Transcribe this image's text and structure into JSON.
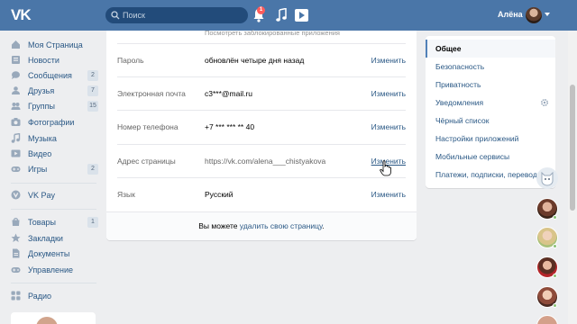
{
  "header": {
    "logo_text": "VK",
    "search_placeholder": "Поиск",
    "notifications_count": "1",
    "user_name": "Алёна"
  },
  "sidebar": {
    "items": [
      {
        "label": "Моя Страница",
        "icon": "home-icon",
        "count": ""
      },
      {
        "label": "Новости",
        "icon": "news-icon",
        "count": ""
      },
      {
        "label": "Сообщения",
        "icon": "messages-icon",
        "count": "2"
      },
      {
        "label": "Друзья",
        "icon": "friends-icon",
        "count": "7"
      },
      {
        "label": "Группы",
        "icon": "groups-icon",
        "count": "15"
      },
      {
        "label": "Фотографии",
        "icon": "camera-icon",
        "count": ""
      },
      {
        "label": "Музыка",
        "icon": "music-icon",
        "count": ""
      },
      {
        "label": "Видео",
        "icon": "video-icon",
        "count": ""
      },
      {
        "label": "Игры",
        "icon": "games-icon",
        "count": "2"
      }
    ],
    "vkpay": {
      "label": "VK Pay",
      "icon": "vkpay-icon"
    },
    "items2": [
      {
        "label": "Товары",
        "icon": "goods-icon",
        "count": "1"
      },
      {
        "label": "Закладки",
        "icon": "star-icon",
        "count": ""
      },
      {
        "label": "Документы",
        "icon": "document-icon",
        "count": ""
      },
      {
        "label": "Управление",
        "icon": "gamepad-icon",
        "count": ""
      }
    ],
    "radio": {
      "label": "Радио",
      "icon": "apps-icon"
    }
  },
  "settings": {
    "faded_text": "Посмотреть заблокированные приложения",
    "rows": [
      {
        "label": "Пароль",
        "value": "обновлён четыре дня назад",
        "action": "Изменить"
      },
      {
        "label": "Электронная почта",
        "value": "c3***@mail.ru",
        "action": "Изменить"
      },
      {
        "label": "Номер телефона",
        "value": "+7 *** *** ** 40",
        "action": "Изменить"
      },
      {
        "label": "Адрес страницы",
        "value": "https://vk.com/alena___chistyakova",
        "action": "Изменить"
      },
      {
        "label": "Язык",
        "value": "Русский",
        "action": "Изменить"
      }
    ],
    "footer_prefix": "Вы можете ",
    "footer_link": "удалить свою страницу",
    "footer_suffix": "."
  },
  "right_menu": {
    "items": [
      "Общее",
      "Безопасность",
      "Приватность",
      "Уведомления",
      "Чёрный список",
      "Настройки приложений",
      "Мобильные сервисы",
      "Платежи, подписки, переводы"
    ],
    "active": "Общее"
  },
  "colors": {
    "header": "#4a76a8",
    "link": "#2a5885",
    "background": "#edeef0"
  }
}
